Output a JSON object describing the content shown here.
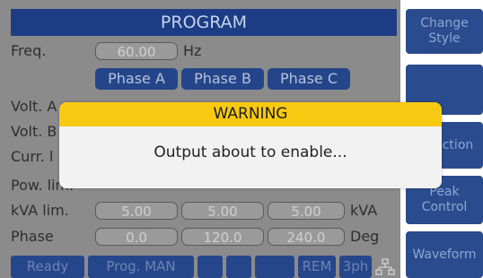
{
  "header": {
    "title": "PROGRAM"
  },
  "rows": {
    "freq": {
      "label": "Freq.",
      "value": "60.00",
      "unit": "Hz"
    },
    "volt_a": {
      "label": "Volt. A"
    },
    "volt_b": {
      "label": "Volt. B"
    },
    "curr": {
      "label": "Curr. l"
    },
    "pow": {
      "label": "Pow. lim."
    },
    "kva": {
      "label": "kVA lim.",
      "values": [
        "5.00",
        "5.00",
        "5.00"
      ],
      "unit": "kVA"
    },
    "phase": {
      "label": "Phase",
      "values": [
        "0.0",
        "120.0",
        "240.0"
      ],
      "unit": "Deg"
    }
  },
  "phases": [
    "Phase A",
    "Phase B",
    "Phase C"
  ],
  "status": {
    "ready": "Ready",
    "prog": "Prog. MAN",
    "rem": "REM",
    "mode": "3ph"
  },
  "sidebar": [
    {
      "line1": "Change",
      "line2": "Style"
    },
    {
      "line1": "",
      "line2": ""
    },
    {
      "line1": "Selection",
      "line2": ""
    },
    {
      "line1": "Peak",
      "line2": "Control"
    },
    {
      "line1": "Waveform",
      "line2": ""
    }
  ],
  "dialog": {
    "title": "WARNING",
    "message": "Output about to enable..."
  },
  "colors": {
    "accent_blue": "#1c3d85",
    "warning_yellow": "#f8c911",
    "panel_gray": "#8b8b8b"
  }
}
